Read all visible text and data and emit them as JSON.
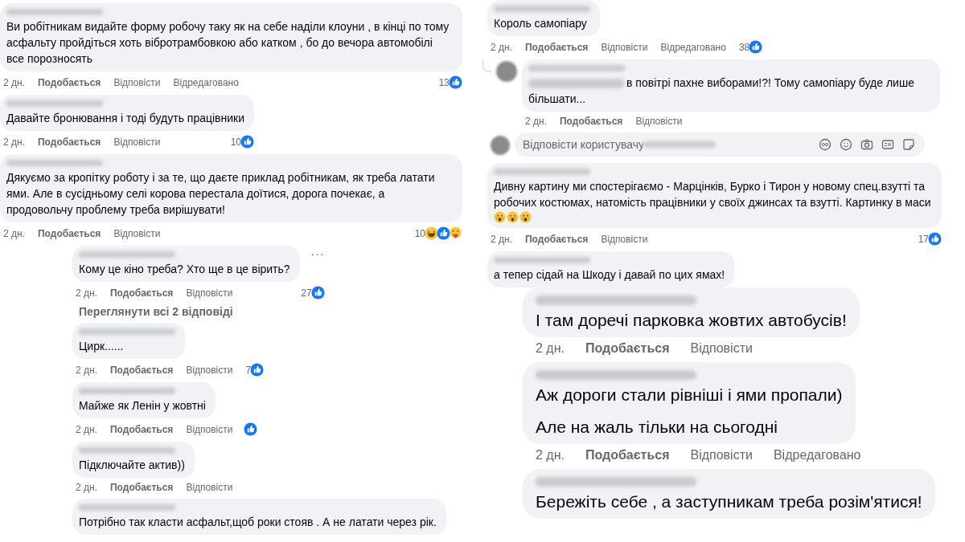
{
  "left_column": {
    "comments": [
      {
        "kind": "comment",
        "avatar": false,
        "mention": false,
        "paragraphs": [
          "Ви робітникам видайте форму робочу таку як на себе наділи клоуни , в кінці по тому асфальту пройдіться хоть вібротрамбовкою або катком , бо до вечора автомобілі все порозносять"
        ],
        "time": "2 дн.",
        "like_action": "Подобається",
        "reply_action": "Відповісти",
        "edited": "Відредаговано",
        "likes": "13",
        "reactions": [
          {
            "kind": "like"
          }
        ]
      },
      {
        "kind": "comment",
        "avatar": false,
        "mention": false,
        "paragraphs": [
          "Давайте бронювання і тоді будуть працівники"
        ],
        "time": "2 дн.",
        "like_action": "Подобається",
        "reply_action": "Відповісти",
        "likes": "10",
        "reactions": [
          {
            "kind": "like"
          }
        ]
      },
      {
        "kind": "comment",
        "avatar": false,
        "mention": false,
        "paragraphs": [
          "Дякуємо за кропітку роботу і за те, що даєте приклад робітникам, як треба латати ями. Але в сусідньому селі корова перестала доїтися, дорога почекає, а продовольчу проблему треба вирішувати!"
        ],
        "time": "2 дн.",
        "like_action": "Подобається",
        "reply_action": "Відповісти",
        "likes": "10",
        "reactions": [
          {
            "kind": "haha"
          },
          {
            "kind": "like"
          },
          {
            "kind": "care"
          }
        ]
      }
    ],
    "replies": [
      {
        "kind": "comment",
        "avatar": false,
        "mention": false,
        "paragraphs": [
          "Кому це кіно треба? Хто ще в це вірить?"
        ],
        "more": "···",
        "time": "2 дн.",
        "like_action": "Подобається",
        "reply_action": "Відповісти",
        "likes": "27",
        "reactions": [
          {
            "kind": "like"
          }
        ]
      },
      {
        "kind": "more_replies",
        "label": "Переглянути всі 2 відповіді"
      },
      {
        "kind": "comment",
        "avatar": false,
        "mention": false,
        "paragraphs": [
          "Цирк......"
        ],
        "time": "2 дн.",
        "like_action": "Подобається",
        "reply_action": "Відповісти",
        "likes": "7",
        "reactions": [
          {
            "kind": "like"
          }
        ]
      },
      {
        "kind": "comment",
        "avatar": false,
        "mention": false,
        "paragraphs": [
          "Майже як Ленін у жовтні"
        ],
        "time": "2 дн.",
        "like_action": "Подобається",
        "reply_action": "Відповісти",
        "reactions": [
          {
            "kind": "like"
          }
        ]
      },
      {
        "kind": "comment",
        "avatar": false,
        "mention": false,
        "paragraphs": [
          "Підключайте актив))"
        ],
        "time": "2 дн.",
        "like_action": "Подобається",
        "reply_action": "Відповісти"
      },
      {
        "kind": "comment",
        "avatar": false,
        "mention": false,
        "paragraphs": [
          "Потрібно так класти асфальт,щоб роки стояв . А не латати через рік."
        ]
      }
    ]
  },
  "right_column": {
    "comments": [
      {
        "kind": "comment",
        "avatar": false,
        "mention": false,
        "paragraphs": [
          "Король самопіару"
        ],
        "time": "2 дн.",
        "like_action": "Подобається",
        "reply_action": "Відповісти",
        "edited": "Відредаговано",
        "likes": "38",
        "reactions": [
          {
            "kind": "like"
          }
        ],
        "children": [
          {
            "kind": "comment",
            "avatar": true,
            "mention": true,
            "paragraphs": [
              "в повітрі пахне виборами!?! Тому самопіару буде лише більшати..."
            ],
            "time": "2 дн.",
            "like_action": "Подобається",
            "reply_action": "Відповісти"
          },
          {
            "kind": "reply_input",
            "placeholder": "Відповісти користувачу"
          }
        ]
      },
      {
        "kind": "comment",
        "avatar": false,
        "mention": false,
        "paragraphs": [
          "Дивну картину ми спостерігаємо - Марцінків, Бурко і Тирон у новому спец.взутті та робочих костюмах, натомість працівники у своїх джинсах та взутті. Картинку в маси"
        ],
        "emojis": [
          {
            "kind": "astonished"
          },
          {
            "kind": "astonished"
          },
          {
            "kind": "astonished"
          }
        ],
        "time": "2 дн.",
        "like_action": "Подобається",
        "reply_action": "Відповісти",
        "likes": "17",
        "reactions": [
          {
            "kind": "like"
          }
        ]
      },
      {
        "kind": "comment",
        "avatar": false,
        "mention": false,
        "paragraphs": [
          "а тепер сідай на Шкоду і давай по цих ямах!"
        ]
      },
      {
        "kind": "comment_large",
        "avatar": false,
        "mention": false,
        "paragraphs": [
          "І там доречі парковка жовтих автобусів!"
        ],
        "time": "2 дн.",
        "like_action": "Подобається",
        "reply_action": "Відповісти"
      },
      {
        "kind": "comment_large",
        "avatar": false,
        "mention": false,
        "paragraphs": [
          "Аж дороги стали рівніші і ями пропали)",
          "Але на жаль тільки на сьогодні"
        ],
        "time": "2 дн.",
        "like_action": "Подобається",
        "reply_action": "Відповісти",
        "edited": "Відредаговано"
      },
      {
        "kind": "comment_large",
        "avatar": false,
        "mention": false,
        "paragraphs": [
          "Бережіть себе , а заступникам треба розім'ятися!"
        ]
      }
    ]
  }
}
